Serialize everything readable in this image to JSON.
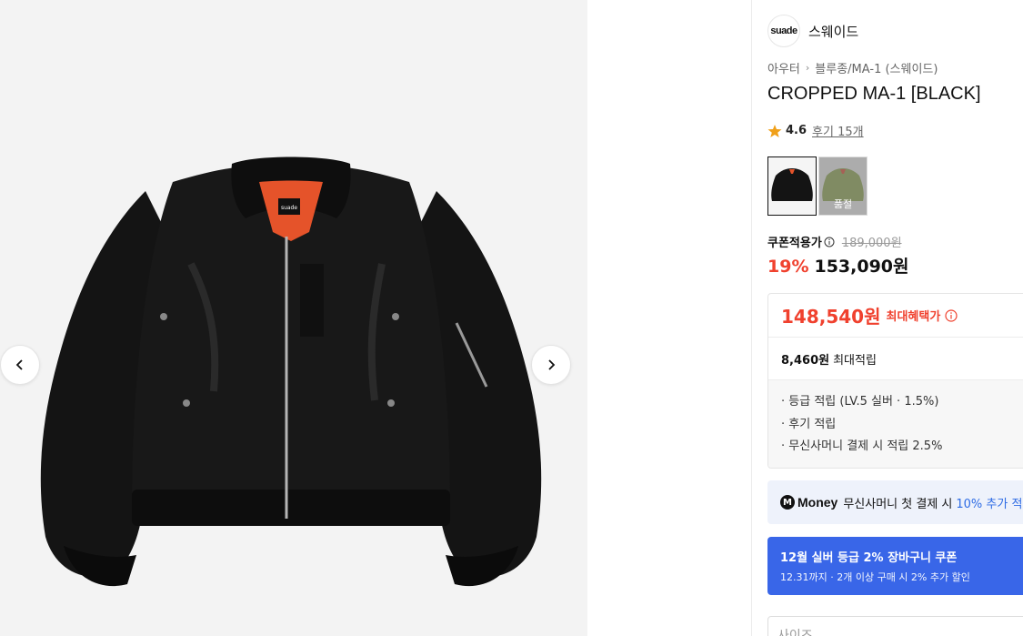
{
  "gallery": {
    "image_alt": "CROPPED MA-1 [BLACK] jacket",
    "prev_icon": "chevron-left-icon",
    "next_icon": "chevron-right-icon",
    "jacket_tag": "suade"
  },
  "brand": {
    "logo_text": "suade",
    "name": "스웨이드"
  },
  "breadcrumb": {
    "items": [
      "아우터",
      "블루종/MA-1 (스웨이드)"
    ],
    "separator": "›"
  },
  "product": {
    "title": "CROPPED MA-1 [BLACK]",
    "rating": "4.6",
    "reviews": "후기 15개",
    "star_color": "#f0a019"
  },
  "swatches": [
    {
      "color": "black",
      "selected": true,
      "label": ""
    },
    {
      "color": "olive",
      "selected": false,
      "label": "품절"
    }
  ],
  "price": {
    "coupon_label": "쿠폰적용가",
    "original": "189,000원",
    "discount": "19%",
    "current": "153,090원",
    "accent_color": "#f0412e"
  },
  "benefits": {
    "max_price": "148,540원",
    "max_label": "최대혜택가",
    "points_value": "8,460원",
    "points_label": "최대적립",
    "items": [
      "· 등급 적립 (LV.5 실버 · 1.5%)",
      "· 후기 적립",
      "· 무신사머니 결제 시 적립 2.5%"
    ]
  },
  "money_banner": {
    "badge": "M",
    "word": "Money",
    "text": "무신사머니 첫 결제 시",
    "highlight": "10% 추가 적"
  },
  "coupon_banner": {
    "title": "12월 실버 등급 2% 장바구니 쿠폰",
    "subtitle": "12.31까지 · 2개 이상 구매 시 2% 추가 할인",
    "bg_color": "#3966e8"
  },
  "size_select": {
    "placeholder": "사이즈"
  }
}
